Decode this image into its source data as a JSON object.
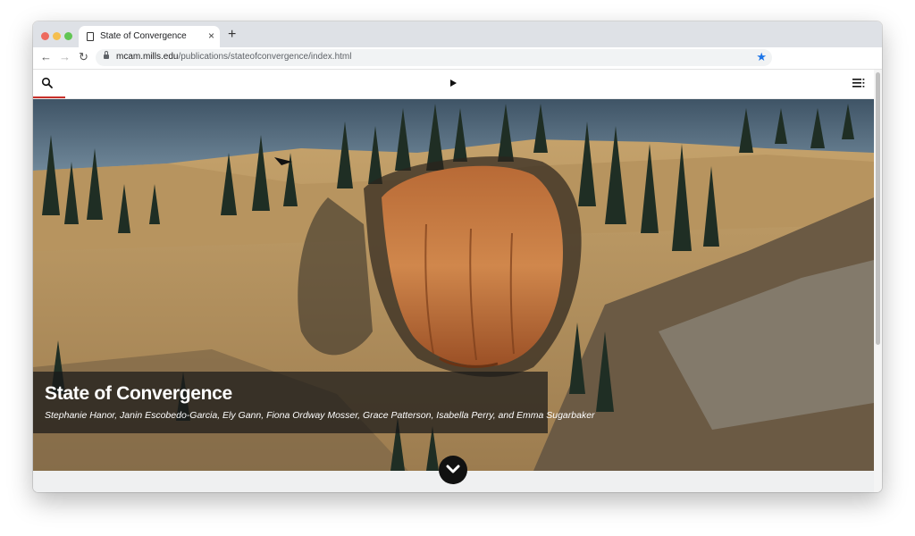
{
  "browser": {
    "tab_title": "State of Convergence",
    "tab_close": "×",
    "new_tab": "+",
    "back": "←",
    "forward": "→",
    "reload": "↻",
    "url_domain": "mcam.mills.edu",
    "url_path": "/publications/stateofconvergence/index.html",
    "star": "★",
    "accent_color": "#1a73e8"
  },
  "site_nav": {
    "search_icon": "search-icon",
    "play_icon": "play-icon",
    "menu_icon": "list-menu-icon",
    "search_accent": "#c8302b"
  },
  "hero": {
    "title": "State of Convergence",
    "authors": "Stephanie Hanor, Janin Escobedo-Garcia, Ely Gann, Fiona Ordway Mosser, Grace Patterson, Isabella Perry, and Emma Sugarbaker",
    "scroll_icon": "chevron-down-icon"
  }
}
